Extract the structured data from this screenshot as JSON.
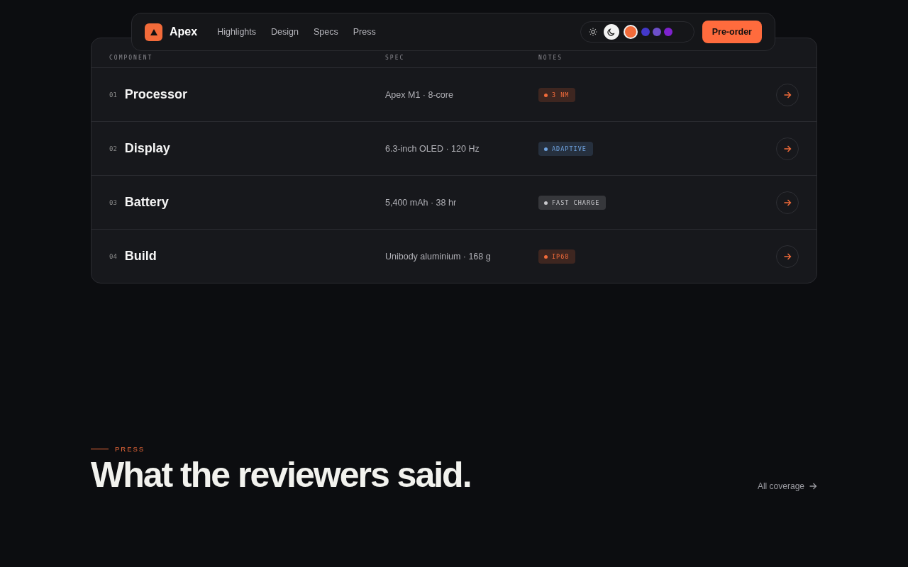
{
  "nav": {
    "brand": "Apex",
    "links": [
      "Highlights",
      "Design",
      "Specs",
      "Press"
    ],
    "themes": [
      {
        "kind": "sun",
        "selected": false
      },
      {
        "kind": "moon",
        "selected": true
      }
    ],
    "swatches": [
      {
        "color": "#f26b3a",
        "selected": true
      },
      {
        "color": "#4338ca",
        "selected": false
      },
      {
        "color": "#6d4fc9",
        "selected": false
      },
      {
        "color": "#7e22ce",
        "selected": false
      }
    ],
    "cta": "Pre-order"
  },
  "table": {
    "columns": [
      "COMPONENT",
      "SPEC",
      "NOTES"
    ],
    "rows": [
      {
        "index": "01",
        "name": "Processor",
        "spec": "Apex M1 · 8-core",
        "note": "3 NM",
        "color": "#f26b3a"
      },
      {
        "index": "02",
        "name": "Display",
        "spec": "6.3-inch OLED · 120 Hz",
        "note": "ADAPTIVE",
        "color": "#6fa3e0"
      },
      {
        "index": "03",
        "name": "Battery",
        "spec": "5,400 mAh · 38 hr",
        "note": "FAST CHARGE",
        "color": "#c8c8cc"
      },
      {
        "index": "04",
        "name": "Build",
        "spec": "Unibody aluminium · 168 g",
        "note": "IP68",
        "color": "#f26b3a"
      }
    ]
  },
  "press": {
    "eyebrow": "PRESS",
    "heading": "What the reviewers said.",
    "link": "All coverage"
  }
}
